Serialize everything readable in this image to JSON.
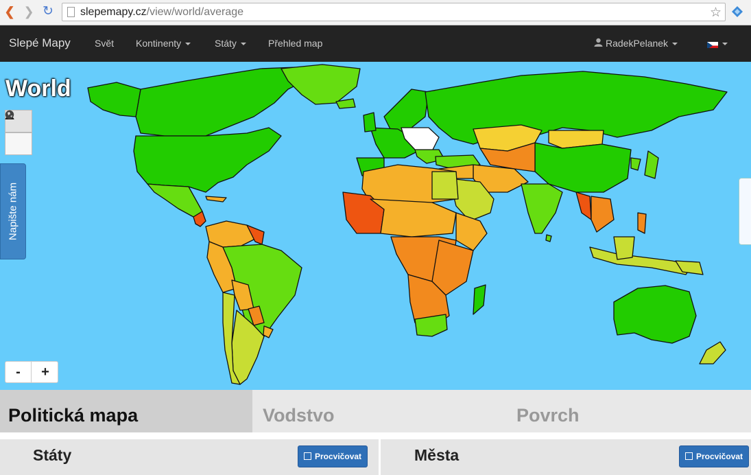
{
  "browser": {
    "url_host": "slepemapy.cz",
    "url_path": "/view/world/average"
  },
  "navbar": {
    "brand": "Slepé Mapy",
    "items": [
      "Svět",
      "Kontinenty",
      "Státy",
      "Přehled map"
    ],
    "user": "RadekPelanek",
    "language_flag": "cz-flag-icon"
  },
  "map": {
    "title": "World",
    "feedback_label": "Napište nám",
    "zoom_out": "-",
    "zoom_in": "+",
    "colors": {
      "ocean": "#66ccfb",
      "known_well": "#22cc00",
      "good": "#66dd11",
      "medium": "#c8dd33",
      "fair": "#f5d033",
      "weak": "#f5b02a",
      "poor": "#f28a1e",
      "bad": "#ee5511",
      "unknown": "#ffffff"
    }
  },
  "category_tabs": [
    "Politická mapa",
    "Vodstvo",
    "Povrch"
  ],
  "sections": {
    "left_title": "Státy",
    "right_title": "Města",
    "practice_label": "Procvičovat"
  }
}
